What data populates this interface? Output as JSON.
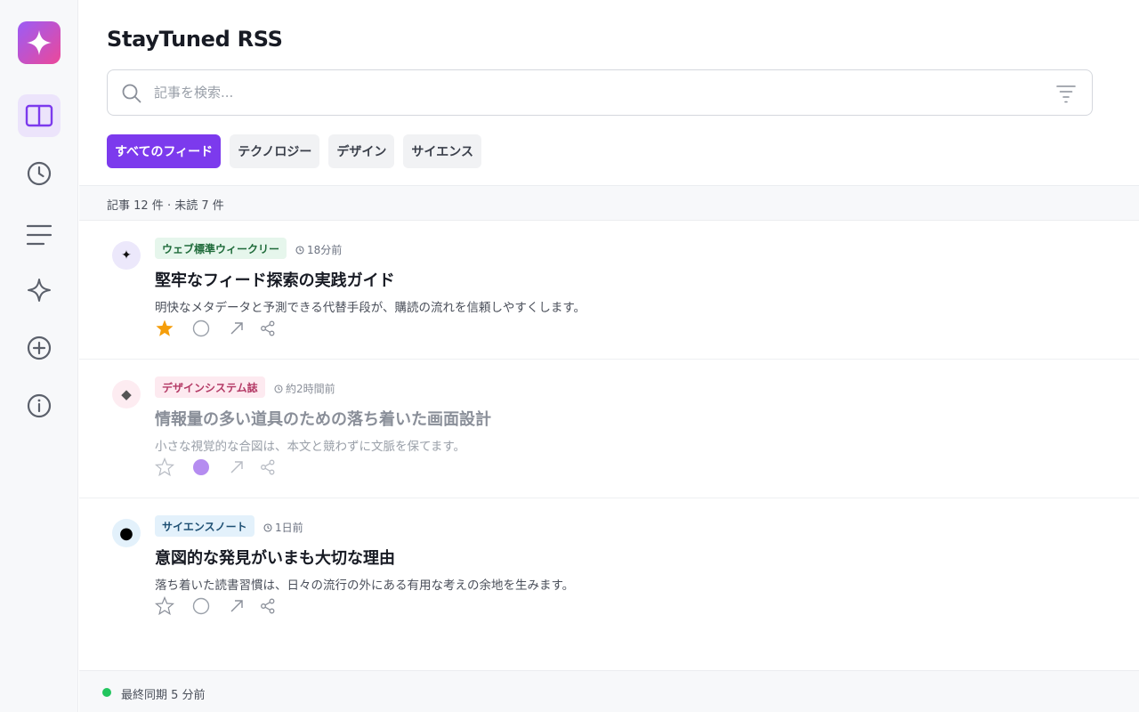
{
  "app": {
    "title": "StayTuned RSS"
  },
  "search": {
    "placeholder": "記事を検索..."
  },
  "chips": [
    {
      "label": "すべてのフィード",
      "active": true
    },
    {
      "label": "テクノロジー",
      "active": false
    },
    {
      "label": "デザイン",
      "active": false
    },
    {
      "label": "サイエンス",
      "active": false
    }
  ],
  "summary": {
    "text": "記事 12 件 · 未読 7 件"
  },
  "articles": [
    {
      "source": "ウェブ標準ウィークリー",
      "time": "18分前",
      "title": "堅牢なフィード探索の実践ガイド",
      "summary": "明快なメタデータと予測できる代替手段が、購読の流れを信頼しやすくします。",
      "starred": true,
      "read": false,
      "icon_glyph": "✦",
      "badge_color": "#e6f6ec",
      "badge_text_color": "#1f6b3a",
      "icon_bg": "#ece8fb"
    },
    {
      "source": "デザインシステム誌",
      "time": "約2時間前",
      "title": "情報量の多い道具のための落ち着いた画面設計",
      "summary": "小さな視覚的な合図は、本文と競わずに文脈を保てます。",
      "starred": false,
      "read": true,
      "icon_glyph": "◆",
      "badge_color": "#fdeaf0",
      "badge_text_color": "#b43a66",
      "icon_bg": "#fdecf1"
    },
    {
      "source": "サイエンスノート",
      "time": "1日前",
      "title": "意図的な発見がいまも大切な理由",
      "summary": "落ち着いた読書習慣は、日々の流行の外にある有用な考えの余地を生みます。",
      "starred": false,
      "read": false,
      "icon_glyph": "●",
      "badge_color": "#e3f1fb",
      "badge_text_color": "#1d4f73",
      "icon_bg": "#e3f1fb"
    }
  ],
  "footer": {
    "status": "最終同期 5 分前"
  },
  "colors": {
    "accent": "#7c3aed",
    "star": "#f59e0b",
    "status_ok": "#22c55e"
  }
}
